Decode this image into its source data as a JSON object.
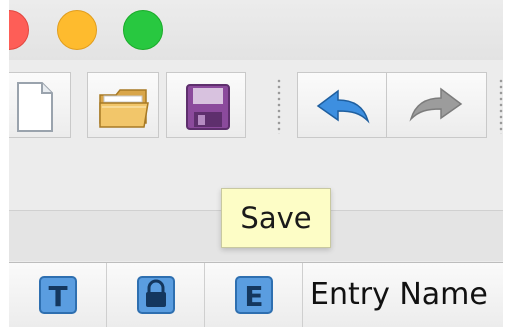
{
  "window": {
    "controls": [
      {
        "name": "close-button",
        "color": "#fe5e57"
      },
      {
        "name": "minimize-button",
        "color": "#febb2e"
      },
      {
        "name": "zoom-button",
        "color": "#28c840"
      }
    ]
  },
  "toolbar": {
    "buttons": [
      {
        "name": "new-button",
        "icon": "new-document-icon"
      },
      {
        "name": "open-button",
        "icon": "folder-open-icon"
      },
      {
        "name": "save-button",
        "icon": "floppy-disk-icon",
        "accent": "#8b4a9c"
      },
      {
        "name": "undo-button",
        "icon": "undo-arrow-icon",
        "accent": "#2f7fd3"
      },
      {
        "name": "redo-button",
        "icon": "redo-arrow-icon",
        "enabled": false
      }
    ]
  },
  "tooltip": {
    "text": "Save"
  },
  "table": {
    "columns": [
      {
        "name": "title-column",
        "icon": "letter-t-icon"
      },
      {
        "name": "lock-column",
        "icon": "lock-icon"
      },
      {
        "name": "entry-column",
        "icon": "letter-e-icon"
      },
      {
        "name": "entry-name-column",
        "label": "Entry Name"
      }
    ]
  }
}
